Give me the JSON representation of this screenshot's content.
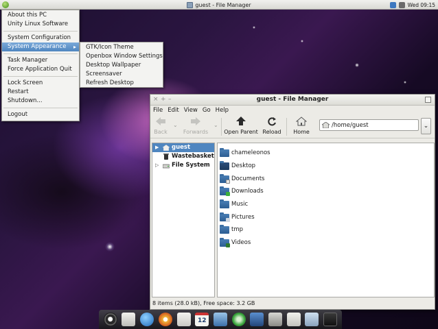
{
  "top_panel": {
    "window_title": "guest - File Manager",
    "clock": "Wed 09:15"
  },
  "start_menu": {
    "items": [
      {
        "label": "About this PC"
      },
      {
        "label": "Unity Linux Software"
      },
      {
        "label": "System Configuration"
      },
      {
        "label": "System Appearance",
        "has_submenu": true,
        "active": true
      },
      {
        "label": "Task Manager"
      },
      {
        "label": "Force Application Quit"
      },
      {
        "label": "Lock Screen"
      },
      {
        "label": "Restart"
      },
      {
        "label": "Shutdown..."
      },
      {
        "label": "Logout"
      }
    ]
  },
  "submenu": {
    "items": [
      {
        "label": "GTK/Icon Theme"
      },
      {
        "label": "Openbox Window Settings"
      },
      {
        "label": "Desktop Wallpaper"
      },
      {
        "label": "Screensaver"
      },
      {
        "label": "Refresh Desktop"
      }
    ]
  },
  "file_manager": {
    "title": "guest - File Manager",
    "menubar": [
      "File",
      "Edit",
      "View",
      "Go",
      "Help"
    ],
    "toolbar": {
      "back": "Back",
      "forwards": "Forwards",
      "open_parent": "Open Parent",
      "reload": "Reload",
      "home": "Home"
    },
    "address": "/home/guest",
    "sidebar": [
      {
        "label": "guest",
        "selected": true
      },
      {
        "label": "Wastebasket"
      },
      {
        "label": "File System"
      }
    ],
    "files": [
      {
        "name": "chameleonos"
      },
      {
        "name": "Desktop"
      },
      {
        "name": "Documents"
      },
      {
        "name": "Downloads"
      },
      {
        "name": "Music"
      },
      {
        "name": "Pictures"
      },
      {
        "name": "tmp"
      },
      {
        "name": "Videos"
      }
    ],
    "status": "8 items (28.0 kB), Free space: 3.2 GB"
  },
  "dock": {
    "icons": [
      "accessibility-icon",
      "home-icon",
      "globe-icon",
      "chromium-icon",
      "mail-icon",
      "calendar-icon",
      "image-viewer-icon",
      "media-player-icon",
      "video-editor-icon",
      "settings-icon",
      "home-folder-icon",
      "window-switcher-icon",
      "trash-icon"
    ],
    "calendar_day": "12"
  },
  "colors": {
    "menu_highlight": "#4f86c0",
    "folder_blue": "#2c5d92"
  }
}
